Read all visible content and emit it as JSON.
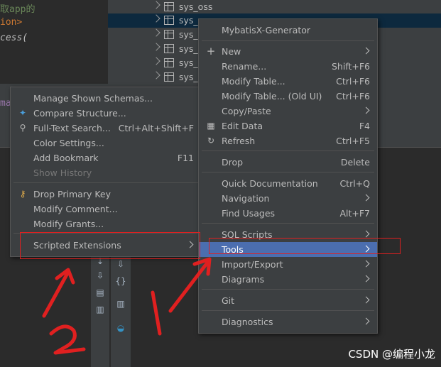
{
  "editor": {
    "lines": [
      "取app的",
      "ion>",
      "cess(",
      "ma"
    ]
  },
  "tree": {
    "rows": [
      {
        "name": "sys_oss"
      },
      {
        "name": "sys_r"
      },
      {
        "name": "sys_r"
      },
      {
        "name": "sys_u"
      },
      {
        "name": "sys_u"
      },
      {
        "name": "sys_u"
      }
    ]
  },
  "left_menu": {
    "items": [
      {
        "label": "Manage Shown Schemas...",
        "shortcut": ""
      },
      {
        "label": "Compare Structure...",
        "shortcut": "",
        "icon": "compare-icon"
      },
      {
        "label": "Full-Text Search...",
        "shortcut": "Ctrl+Alt+Shift+F",
        "icon": "search-icon"
      },
      {
        "label": "Color Settings...",
        "shortcut": ""
      },
      {
        "label": "Add Bookmark",
        "shortcut": "F11"
      },
      {
        "label": "Show History",
        "shortcut": "",
        "disabled": true
      },
      {
        "label": "Drop Primary Key",
        "shortcut": "",
        "icon": "key-icon"
      },
      {
        "label": "Modify Comment...",
        "shortcut": ""
      },
      {
        "label": "Modify Grants...",
        "shortcut": ""
      },
      {
        "label": "Scripted Extensions",
        "shortcut": "",
        "submenu": true
      }
    ]
  },
  "right_menu": {
    "items": [
      {
        "label": "MybatisX-Generator",
        "shortcut": ""
      },
      {
        "label": "New",
        "shortcut": "",
        "submenu": true,
        "icon": "plus-icon"
      },
      {
        "label": "Rename...",
        "shortcut": "Shift+F6"
      },
      {
        "label": "Modify Table...",
        "shortcut": "Ctrl+F6"
      },
      {
        "label": "Modify Table... (Old UI)",
        "shortcut": "Ctrl+F6"
      },
      {
        "label": "Copy/Paste",
        "shortcut": "",
        "submenu": true
      },
      {
        "label": "Edit Data",
        "shortcut": "F4",
        "icon": "table-icon"
      },
      {
        "label": "Refresh",
        "shortcut": "Ctrl+F5",
        "icon": "refresh-icon"
      },
      {
        "label": "Drop",
        "shortcut": "Delete"
      },
      {
        "label": "Quick Documentation",
        "shortcut": "Ctrl+Q"
      },
      {
        "label": "Navigation",
        "shortcut": "",
        "submenu": true
      },
      {
        "label": "Find Usages",
        "shortcut": "Alt+F7"
      },
      {
        "label": "SQL Scripts",
        "shortcut": "",
        "submenu": true
      },
      {
        "label": "Tools",
        "shortcut": "",
        "submenu": true,
        "highlighted": true
      },
      {
        "label": "Import/Export",
        "shortcut": "",
        "submenu": true
      },
      {
        "label": "Diagrams",
        "shortcut": "",
        "submenu": true
      },
      {
        "label": "Git",
        "shortcut": "",
        "submenu": true
      },
      {
        "label": "Diagnostics",
        "shortcut": "",
        "submenu": true
      }
    ]
  },
  "annotation": {
    "color": "#e02020",
    "labels": [
      "2",
      "1"
    ]
  },
  "watermark": "CSDN @编程小龙",
  "colors": {
    "menu_bg": "#3c3f41",
    "highlight": "#4b6eaf",
    "editor_bg": "#2b2b2b",
    "tree_selected": "#0d293e"
  }
}
